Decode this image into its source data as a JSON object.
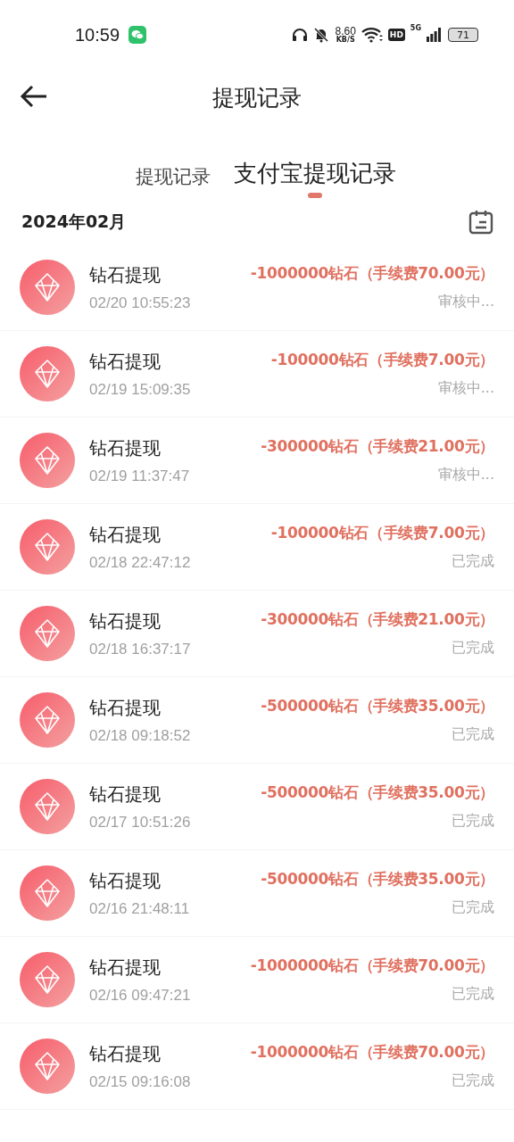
{
  "status_bar": {
    "time": "10:59",
    "net_speed": "8.60",
    "net_unit": "KB/S",
    "hd": "HD",
    "network": "5G",
    "battery": "71"
  },
  "header": {
    "title": "提现记录"
  },
  "tabs": [
    {
      "label": "提现记录",
      "selected": false
    },
    {
      "label": "支付宝提现记录",
      "selected": true
    }
  ],
  "month": "2024年02月",
  "records": [
    {
      "title": "钻石提现",
      "time": "02/20 10:55:23",
      "amount": "-1000000钻石（手续费70.00元）",
      "status": "审核中..."
    },
    {
      "title": "钻石提现",
      "time": "02/19 15:09:35",
      "amount": "-100000钻石（手续费7.00元）",
      "status": "审核中..."
    },
    {
      "title": "钻石提现",
      "time": "02/19 11:37:47",
      "amount": "-300000钻石（手续费21.00元）",
      "status": "审核中..."
    },
    {
      "title": "钻石提现",
      "time": "02/18 22:47:12",
      "amount": "-100000钻石（手续费7.00元）",
      "status": "已完成"
    },
    {
      "title": "钻石提现",
      "time": "02/18 16:37:17",
      "amount": "-300000钻石（手续费21.00元）",
      "status": "已完成"
    },
    {
      "title": "钻石提现",
      "time": "02/18 09:18:52",
      "amount": "-500000钻石（手续费35.00元）",
      "status": "已完成"
    },
    {
      "title": "钻石提现",
      "time": "02/17 10:51:26",
      "amount": "-500000钻石（手续费35.00元）",
      "status": "已完成"
    },
    {
      "title": "钻石提现",
      "time": "02/16 21:48:11",
      "amount": "-500000钻石（手续费35.00元）",
      "status": "已完成"
    },
    {
      "title": "钻石提现",
      "time": "02/16 09:47:21",
      "amount": "-1000000钻石（手续费70.00元）",
      "status": "已完成"
    },
    {
      "title": "钻石提现",
      "time": "02/15 09:16:08",
      "amount": "-1000000钻石（手续费70.00元）",
      "status": "已完成"
    }
  ]
}
